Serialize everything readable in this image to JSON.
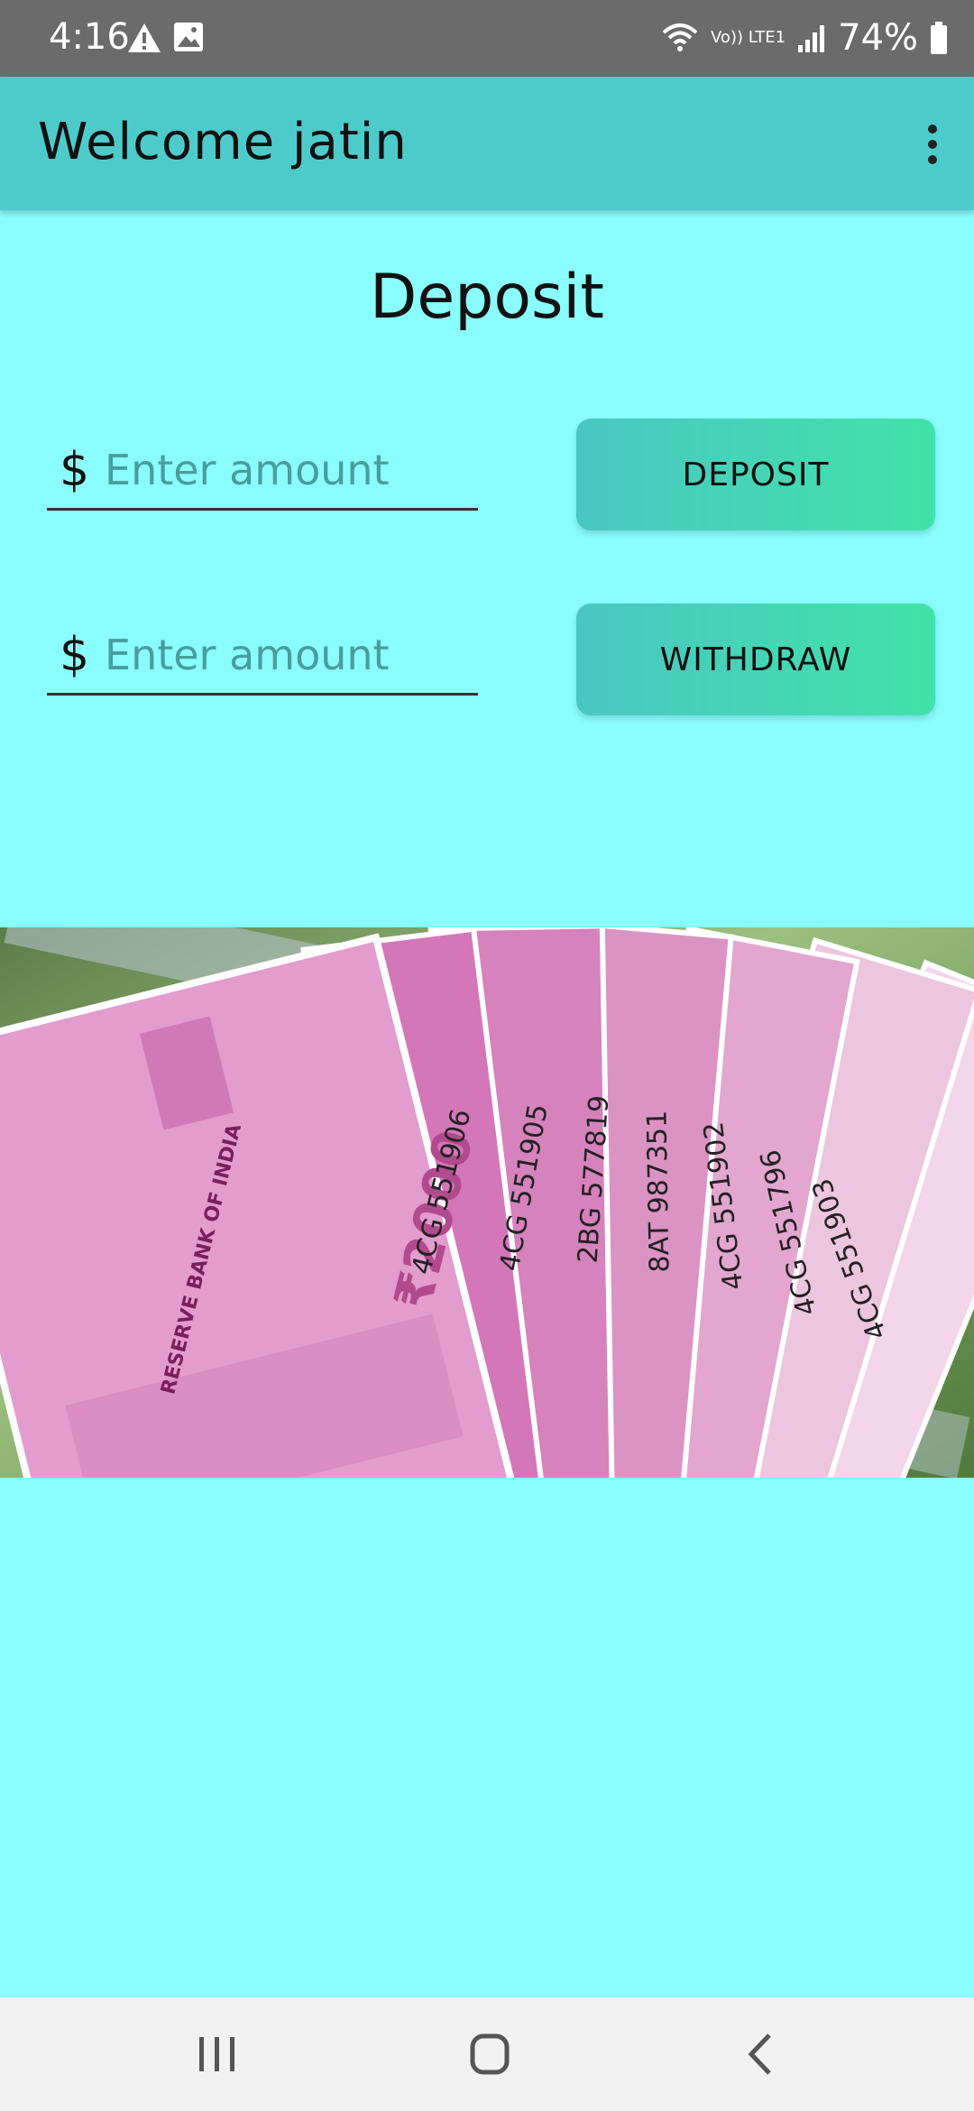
{
  "status_bar": {
    "time": "4:16",
    "network_label": "Vo)) LTE1",
    "battery": "74%",
    "icons": [
      "warning-icon",
      "image-icon",
      "wifi-icon",
      "signal-icon",
      "battery-icon"
    ]
  },
  "app_bar": {
    "title": "Welcome jatin",
    "menu_icon": "overflow-menu-icon"
  },
  "page": {
    "title": "Deposit"
  },
  "deposit_row": {
    "currency_symbol": "$",
    "placeholder": "Enter amount",
    "value": "",
    "button_label": "DEPOSIT"
  },
  "withdraw_row": {
    "currency_symbol": "$",
    "placeholder": "Enter amount",
    "value": "",
    "button_label": "WITHDRAW"
  },
  "banner": {
    "image": "currency-notes-image",
    "notes": [
      {
        "serial": "4CG 551906"
      },
      {
        "serial": "4CG 551905"
      },
      {
        "serial": "2BG 577819"
      },
      {
        "serial": "8AT 987351"
      },
      {
        "serial": "4CG 551902"
      },
      {
        "serial": "4CG 551796"
      },
      {
        "serial": "4CG 551903"
      }
    ],
    "bank_text": "RESERVE BANK OF INDIA",
    "denomination": "₹2000"
  },
  "nav_bar": {
    "icons": [
      "recents-icon",
      "home-icon",
      "back-icon"
    ]
  },
  "colors": {
    "background": "#8afefe",
    "app_bar": "#4dcbcb",
    "status_bar": "#6b6b6b",
    "button_start": "#4ac6c2",
    "button_end": "#41e3a9",
    "note_pink": "#d873b8"
  }
}
